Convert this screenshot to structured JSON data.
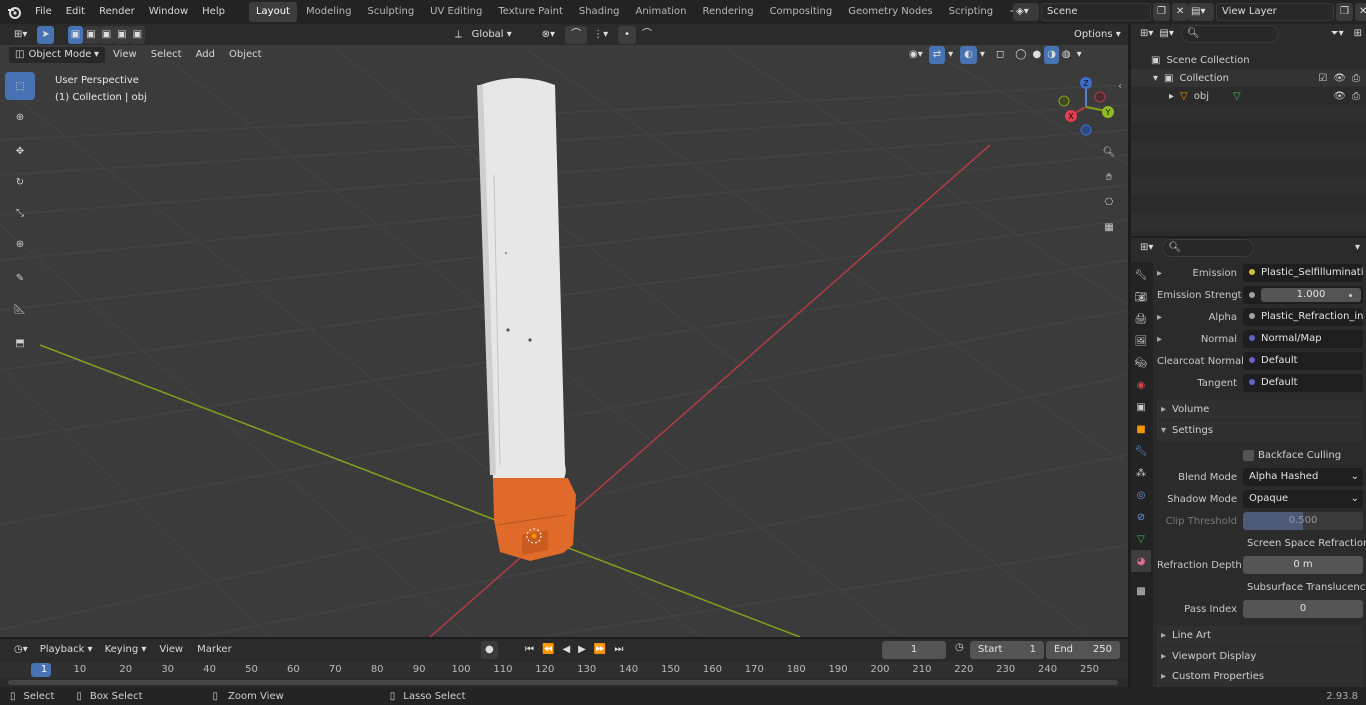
{
  "app": {
    "version": "2.93.8"
  },
  "topbar": {
    "menus": [
      "File",
      "Edit",
      "Render",
      "Window",
      "Help"
    ],
    "workspaces": [
      "Layout",
      "Modeling",
      "Sculpting",
      "UV Editing",
      "Texture Paint",
      "Shading",
      "Animation",
      "Rendering",
      "Compositing",
      "Geometry Nodes",
      "Scripting"
    ],
    "active_workspace": "Layout",
    "scene": "Scene",
    "view_layer": "View Layer"
  },
  "viewport": {
    "transform_orientation": "Global",
    "options_label": "Options",
    "mode": "Object Mode",
    "menus": [
      "View",
      "Select",
      "Add",
      "Object"
    ],
    "overlay_line1": "User Perspective",
    "overlay_line2": "(1) Collection | obj",
    "gizmo": {
      "z": "Z",
      "y": "Y",
      "x": "X"
    }
  },
  "outliner": {
    "items": [
      {
        "label": "Scene Collection"
      },
      {
        "label": "Collection"
      },
      {
        "label": "obj"
      }
    ]
  },
  "properties": {
    "rows": [
      {
        "label": "Emission",
        "value": "Plastic_Selfilluminati...",
        "dot": "#c7c729",
        "expand": true
      },
      {
        "label": "Emission Strengt",
        "value": "1.000",
        "dot": "#a1a1a1",
        "center": true
      },
      {
        "label": "Alpha",
        "value": "Plastic_Refraction_in...",
        "dot": "#a1a1a1",
        "expand": true
      },
      {
        "label": "Normal",
        "value": "Normal/Map",
        "dot": "#6363c7",
        "expand": true
      },
      {
        "label": "Clearcoat Normal",
        "value": "Default",
        "dot": "#6363c7"
      },
      {
        "label": "Tangent",
        "value": "Default",
        "dot": "#6363c7"
      }
    ],
    "sections": {
      "volume": "Volume",
      "settings": "Settings",
      "line_art": "Line Art",
      "viewport_display": "Viewport Display",
      "custom_properties": "Custom Properties"
    },
    "settings": {
      "backface_culling": "Backface Culling",
      "blend_mode_label": "Blend Mode",
      "blend_mode": "Alpha Hashed",
      "shadow_mode_label": "Shadow Mode",
      "shadow_mode": "Opaque",
      "clip_threshold_label": "Clip Threshold",
      "clip_threshold": "0.500",
      "ssr": "Screen Space Refraction",
      "refraction_depth_label": "Refraction Depth",
      "refraction_depth": "0 m",
      "subsurface": "Subsurface Translucency",
      "pass_index_label": "Pass Index",
      "pass_index": "0"
    }
  },
  "timeline": {
    "menus": [
      "Playback",
      "Keying",
      "View",
      "Marker"
    ],
    "current_frame": "1",
    "start_label": "Start",
    "start": "1",
    "end_label": "End",
    "end": "250",
    "ruler": [
      "1",
      "10",
      "20",
      "30",
      "40",
      "50",
      "60",
      "70",
      "80",
      "90",
      "100",
      "110",
      "120",
      "130",
      "140",
      "150",
      "160",
      "170",
      "180",
      "190",
      "200",
      "210",
      "220",
      "230",
      "240",
      "250"
    ]
  },
  "statusbar": {
    "select": "Select",
    "box_select": "Box Select",
    "zoom_view": "Zoom View",
    "lasso_select": "Lasso Select"
  },
  "colors": {
    "accent": "#4772b3",
    "header": "#2b2b2b",
    "viewport": "#3b3b3b",
    "x_axis": "#b43c48",
    "y_axis": "#7ea21f"
  }
}
